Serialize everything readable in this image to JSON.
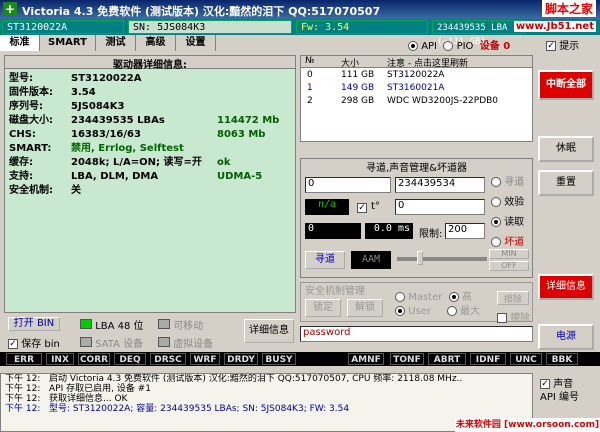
{
  "window": {
    "title": "Victoria 4.3 免费软件 (测试版本) 汉化:黯然的泪下 QQ:517070507",
    "watermark": "脚本之家",
    "watermark_url": "www.Jb51.net"
  },
  "info": {
    "model": "ST3120022A",
    "sn": "SN: 5JS084K3",
    "fw": "Fw: 3.54",
    "lba": "234439535 LBA (~111 GB)"
  },
  "tabs": [
    "标准",
    "SMART",
    "测试",
    "高级",
    "设置"
  ],
  "mode": {
    "api": "API",
    "pio": "PIO",
    "device": "设备 0",
    "hint": "提示"
  },
  "details": {
    "title": "驱动器详细信息:",
    "rows": [
      {
        "k": "型号:",
        "v": "ST3120022A",
        "v2": ""
      },
      {
        "k": "固件版本:",
        "v": "3.54",
        "v2": ""
      },
      {
        "k": "序列号:",
        "v": "5JS084K3",
        "v2": ""
      },
      {
        "k": "磁盘大小:",
        "v": "234439535 LBAs",
        "v2": "114472 Mb"
      },
      {
        "k": "CHS:",
        "v": "16383/16/63",
        "v2": "8063 Mb"
      },
      {
        "k": "SMART:",
        "v": "禁用, Errlog, Selftest",
        "v2": ""
      },
      {
        "k": "缓存:",
        "v": "2048k; L/A=ON; 读写=开",
        "v2": "ok"
      },
      {
        "k": "支持:",
        "v": "LBA, DLM, DMA",
        "v2": "UDMA-5"
      },
      {
        "k": "安全机制:",
        "v": "关",
        "v2": ""
      }
    ]
  },
  "drives": {
    "headers": [
      "№",
      "大小",
      "注意 - 点击这里刷新"
    ],
    "rows": [
      {
        "n": "0",
        "size": "111 GB",
        "name": "ST3120022A"
      },
      {
        "n": "1",
        "size": "149 GB",
        "name": "ST3160021A"
      },
      {
        "n": "2",
        "size": "298 GB",
        "name": "WDC WD3200JS-22PDB0"
      }
    ]
  },
  "seek": {
    "title": "寻道,声音管理&坏道器",
    "start": "0",
    "end": "234439534",
    "na": "n/a",
    "t_label": "t°",
    "t_val": "0",
    "pos": "0",
    "ms": "0.0",
    "ms_unit": "ms",
    "limit_label": "限制:",
    "limit": "200",
    "seek_btn": "寻道",
    "aam": "AAM",
    "min": "MIN",
    "off": "OFF",
    "opts": [
      "寻道",
      "效验",
      "读取",
      "坏道"
    ]
  },
  "security": {
    "title": "安全机制管理",
    "lock": "锁定",
    "unlock": "解锁",
    "master": "Master",
    "high": "高",
    "user": "User",
    "max": "最大",
    "erase": "擦除",
    "erase_chk": "擦除"
  },
  "bottom_ctrl": {
    "open_bin": "打开 BIN",
    "save_bin": "保存 bin",
    "lba48": "LBA 48 位",
    "sata": "SATA 设备",
    "removable": "可移动",
    "virtual": "虚拟设备",
    "detail_btn": "详细信息",
    "password": "password"
  },
  "right": {
    "break_all": "中断全部",
    "sleep": "休眠",
    "reset": "重置",
    "detail": "详细信息",
    "power": "电源",
    "sound": "声音",
    "api_num": "API 编号"
  },
  "status": [
    "ERR",
    "INX",
    "CORR",
    "DEQ",
    "DRSC",
    "WRF",
    "DRDY",
    "BUSY",
    "AMNF",
    "TONF",
    "ABRT",
    "IDNF",
    "UNC",
    "BBK"
  ],
  "log": [
    {
      "t": "下午 12:",
      "m": "启动 Victoria 4.3 免费软件 (测试版本) 汉化:黯然的泪下 QQ:517070507, CPU 频率: 2118.08 MHz.."
    },
    {
      "t": "下午 12:",
      "m": "API 存取已启用, 设备 #1"
    },
    {
      "t": "下午 12:",
      "m": "获取详细信息... OK"
    },
    {
      "t": "下午 12:",
      "m": "型号: ST3120022A;      容量: 234439535 LBAs;  SN: 5JS084K3; FW: 3.54"
    }
  ],
  "footer": "未来软件园 [www.orsoon.com]"
}
